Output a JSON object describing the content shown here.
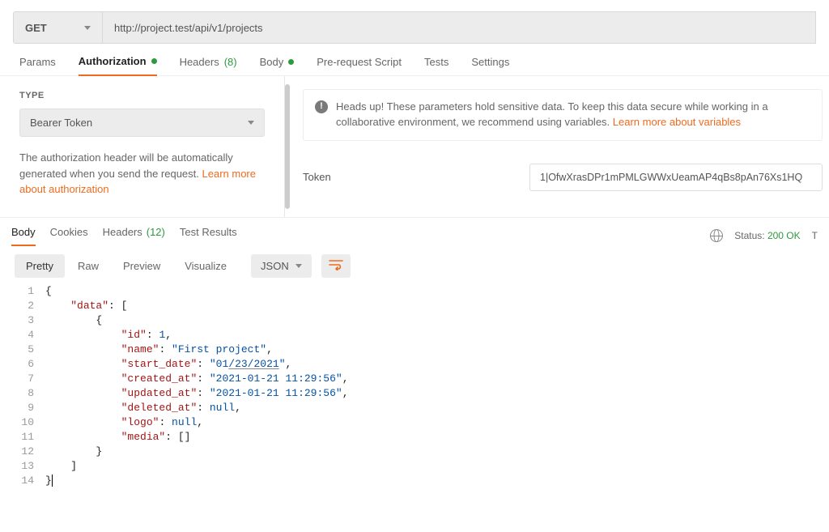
{
  "request": {
    "method": "GET",
    "url": "http://project.test/api/v1/projects"
  },
  "tabs": {
    "params": "Params",
    "authorization": "Authorization",
    "headers": "Headers",
    "headers_count": "(8)",
    "body": "Body",
    "prerequest": "Pre-request Script",
    "tests": "Tests",
    "settings": "Settings"
  },
  "auth": {
    "type_label": "TYPE",
    "type_value": "Bearer Token",
    "desc_prefix": "The authorization header will be automatically generated when you send the request. ",
    "desc_link": "Learn more about authorization",
    "warn_prefix": "Heads up! These parameters hold sensitive data. To keep this data secure while working in a collaborative environment, we recommend using variables. ",
    "warn_link": "Learn more about variables",
    "token_label": "Token",
    "token_value": "1|OfwXrasDPr1mPMLGWWxUeamAP4qBs8pAn76Xs1HQ"
  },
  "resp_tabs": {
    "body": "Body",
    "cookies": "Cookies",
    "headers": "Headers",
    "headers_count": "(12)",
    "test_results": "Test Results"
  },
  "status": {
    "label": "Status:",
    "value": "200 OK",
    "time_prefix": "T"
  },
  "view": {
    "pretty": "Pretty",
    "raw": "Raw",
    "preview": "Preview",
    "visualize": "Visualize",
    "fmt": "JSON"
  },
  "code_lines": [
    "{",
    "    \"data\": [",
    "        {",
    "            \"id\": 1,",
    "            \"name\": \"First project\",",
    "            \"start_date\": \"01/23/2021\",",
    "            \"created_at\": \"2021-01-21 11:29:56\",",
    "            \"updated_at\": \"2021-01-21 11:29:56\",",
    "            \"deleted_at\": null,",
    "            \"logo\": null,",
    "            \"media\": []",
    "        }",
    "    ]",
    "}"
  ],
  "json_response": {
    "data": [
      {
        "id": 1,
        "name": "First project",
        "start_date": "01/23/2021",
        "created_at": "2021-01-21 11:29:56",
        "updated_at": "2021-01-21 11:29:56",
        "deleted_at": null,
        "logo": null,
        "media": []
      }
    ]
  }
}
